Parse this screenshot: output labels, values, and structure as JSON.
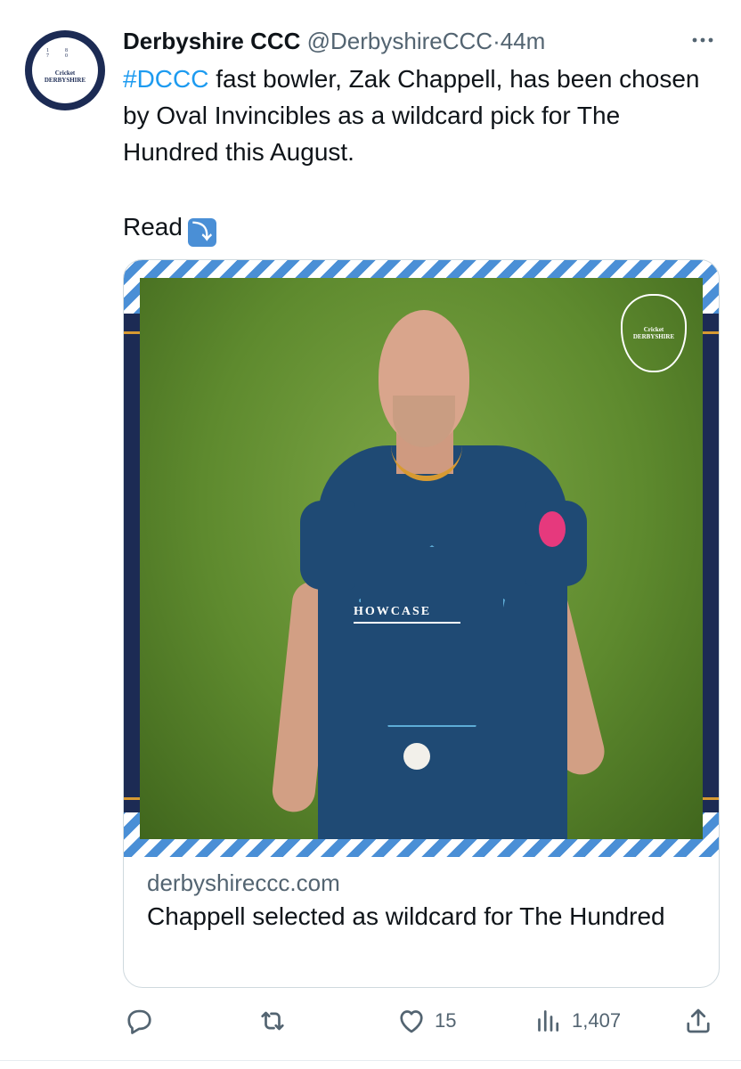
{
  "account": {
    "name": "Derbyshire CCC",
    "handle": "@DerbyshireCCC",
    "separator": "·",
    "time": "44m",
    "avatar_text": "Cricket DERBYSHIRE",
    "avatar_year": "18 70"
  },
  "tweet": {
    "hashtag": "#DCCC",
    "text_rest": " fast bowler, Zak Chappell,  has been chosen by Oval Invincibles as a wildcard pick for The Hundred this August.",
    "read": "Read",
    "read_emoji": "⤵"
  },
  "card": {
    "image_logo_text": "Cricket DERBYSHIRE",
    "sponsor_text": "HOWCASE",
    "domain": "derbyshireccc.com",
    "title": "Chappell selected as wildcard for The Hundred"
  },
  "actions": {
    "reply_count": "",
    "retweet_count": "",
    "like_count": "15",
    "views_count": "1,407"
  },
  "icons": {
    "more": "more-icon",
    "reply": "reply-icon",
    "retweet": "retweet-icon",
    "like": "heart-icon",
    "views": "views-icon",
    "share": "share-icon"
  },
  "colors": {
    "link": "#1d9bf0",
    "secondary_text": "#536471",
    "club_navy": "#1c2b54",
    "club_blue": "#4a8fd6",
    "club_gold": "#d79a32"
  }
}
